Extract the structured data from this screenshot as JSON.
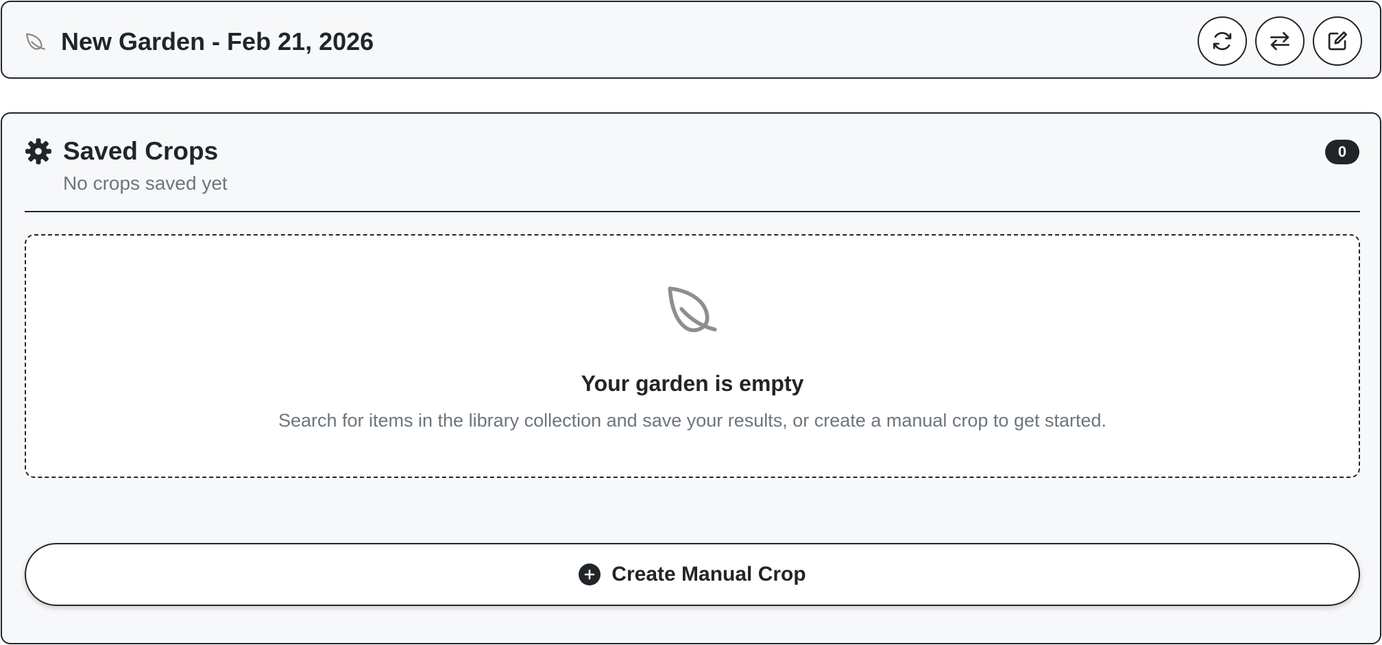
{
  "header": {
    "title": "New Garden - Feb 21, 2026",
    "icon": "leaf-icon",
    "actions": [
      {
        "name": "refresh-button",
        "icon": "refresh-icon"
      },
      {
        "name": "swap-button",
        "icon": "swap-arrows-icon"
      },
      {
        "name": "edit-button",
        "icon": "edit-icon"
      }
    ]
  },
  "saved_crops": {
    "icon": "gear-icon",
    "title": "Saved Crops",
    "subtitle": "No crops saved yet",
    "count": "0"
  },
  "empty_state": {
    "icon": "leaf-icon",
    "title": "Your garden is empty",
    "description": "Search for items in the library collection and save your results, or create a manual crop to get started."
  },
  "create_button": {
    "icon": "plus-circle-icon",
    "label": "Create Manual Crop"
  },
  "colors": {
    "text": "#212529",
    "muted_text": "#6c757d",
    "card_background": "#f7f8fa",
    "icon_gray": "#8e8e8e"
  }
}
